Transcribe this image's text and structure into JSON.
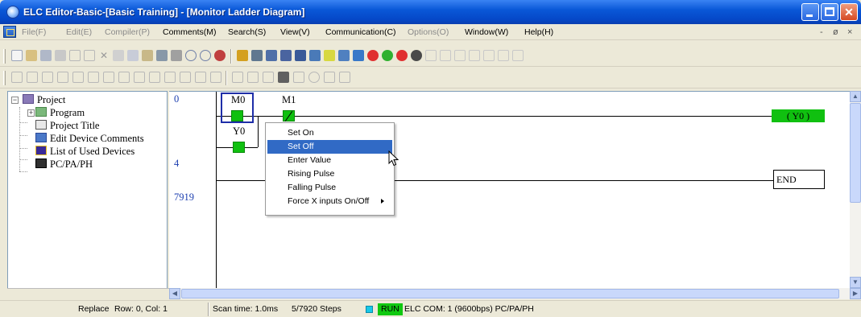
{
  "window": {
    "title": "ELC Editor-Basic-[Basic Training] - [Monitor Ladder Diagram]"
  },
  "menu": {
    "items": [
      {
        "label": "File(F)",
        "enabled": false
      },
      {
        "label": "Edit(E)",
        "enabled": false
      },
      {
        "label": "Compiler(P)",
        "enabled": false
      },
      {
        "label": "Comments(M)",
        "enabled": true
      },
      {
        "label": "Search(S)",
        "enabled": true
      },
      {
        "label": "View(V)",
        "enabled": true
      },
      {
        "label": "Communication(C)",
        "enabled": true
      },
      {
        "label": "Options(O)",
        "enabled": false
      },
      {
        "label": "Window(W)",
        "enabled": true
      },
      {
        "label": "Help(H)",
        "enabled": true
      }
    ],
    "mdi_min": "-",
    "mdi_restore": "ø",
    "mdi_close": "×"
  },
  "tree": {
    "root": "Project",
    "items": [
      "Program",
      "Project Title",
      "Edit Device Comments",
      "List of Used Devices",
      "PC/PA/PH"
    ],
    "root_expander": "−",
    "program_expander": "+"
  },
  "ladder": {
    "steps": [
      "0",
      "4",
      "7919"
    ],
    "contacts": {
      "m0": "M0",
      "m1": "M1",
      "y0": "Y0"
    },
    "coil": "(  Y0   )",
    "end": "END"
  },
  "context_menu": {
    "items": [
      "Set On",
      "Set Off",
      "Enter Value",
      "Rising Pulse",
      "Falling Pulse",
      "Force X inputs On/Off"
    ],
    "highlighted": "Set Off"
  },
  "status": {
    "mode": "Replace",
    "position": "Row: 0, Col: 1",
    "scan_time": "Scan time: 1.0ms",
    "steps": "5/7920 Steps",
    "run": "RUN",
    "com": "ELC COM: 1  (9600bps) PC/PA/PH"
  },
  "colors": {
    "titlebar": "#0a58d8",
    "contact_on": "#10c010",
    "menu_highlight": "#316ac5",
    "run_indicator": "#10c810"
  }
}
